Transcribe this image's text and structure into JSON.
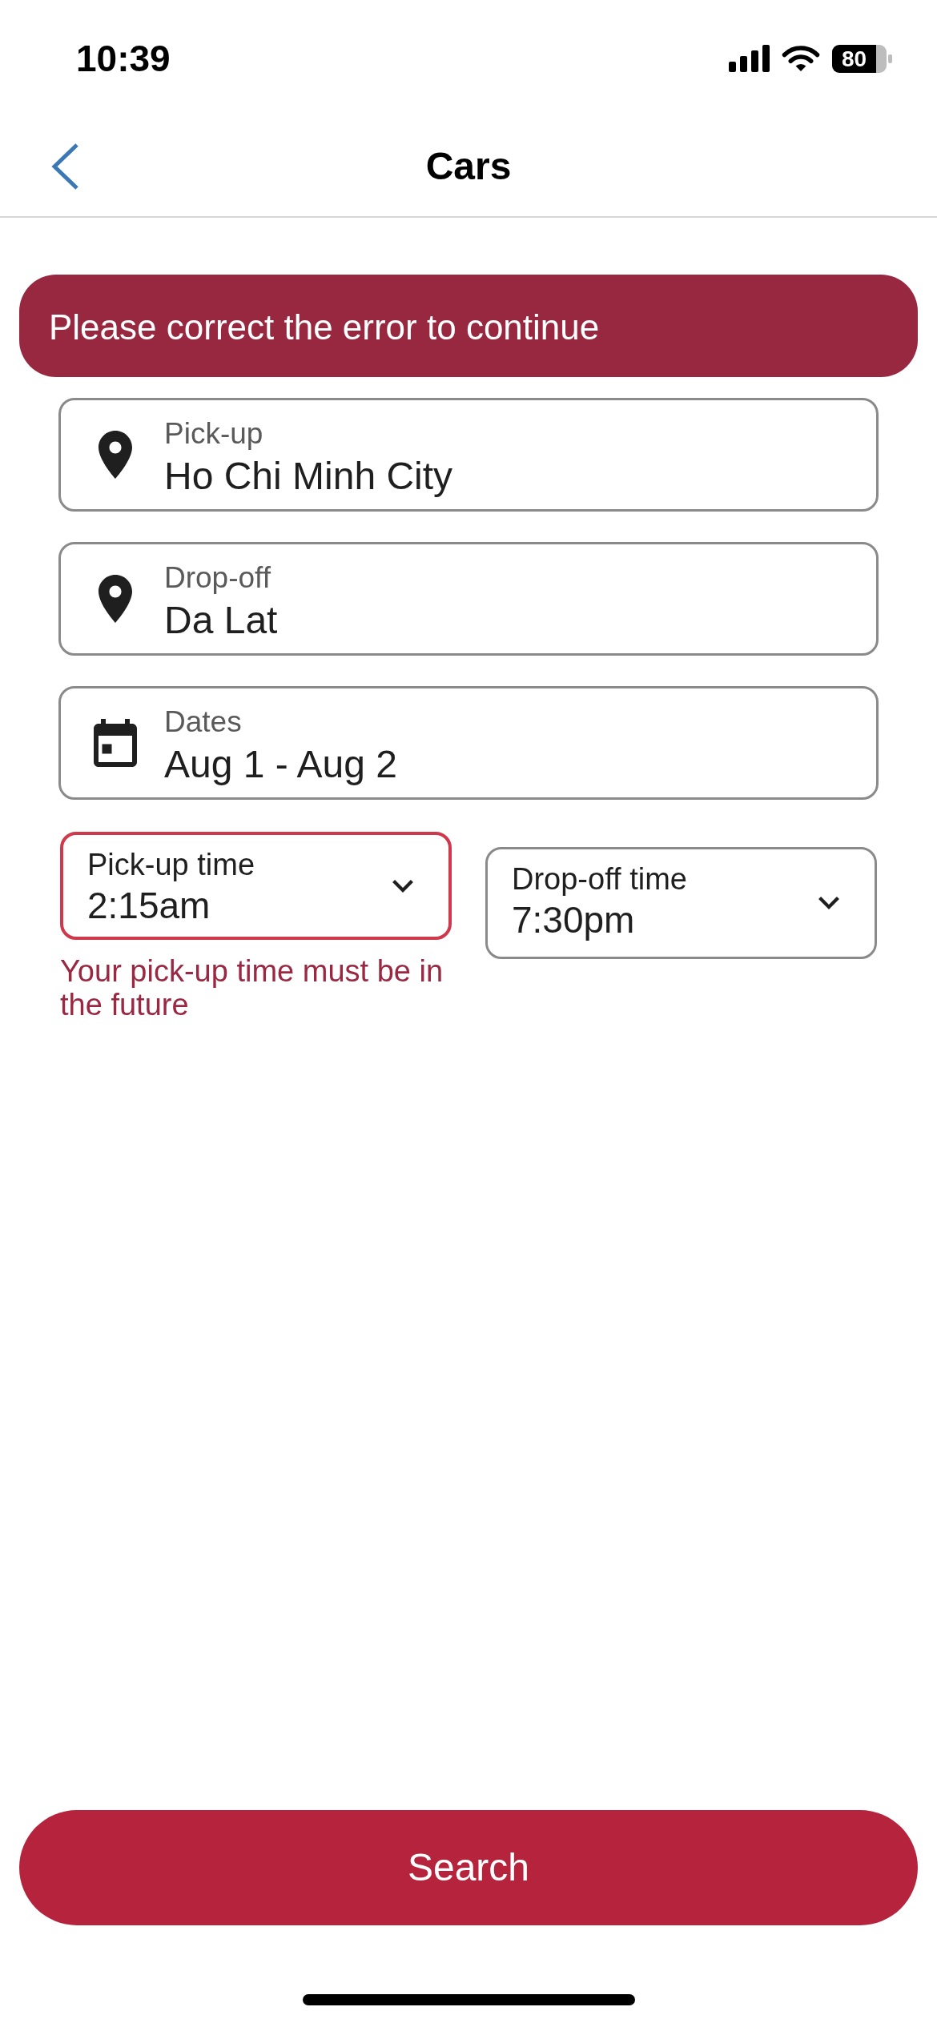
{
  "status_bar": {
    "time": "10:39",
    "battery": "80"
  },
  "header": {
    "title": "Cars"
  },
  "error_banner": {
    "message": "Please correct the error to continue"
  },
  "fields": [
    {
      "kind": "location",
      "label": "Pick-up",
      "value": "Ho Chi Minh City"
    },
    {
      "kind": "location",
      "label": "Drop-off",
      "value": "Da Lat"
    },
    {
      "kind": "dates",
      "label": "Dates",
      "value": "Aug 1 - Aug 2"
    }
  ],
  "time_fields": [
    {
      "label": "Pick-up time",
      "value": "2:15am",
      "invalid": true,
      "error": "Your pick-up time must be in the future"
    },
    {
      "label": "Drop-off time",
      "value": "7:30pm",
      "invalid": false
    }
  ],
  "search_button": {
    "label": "Search"
  }
}
